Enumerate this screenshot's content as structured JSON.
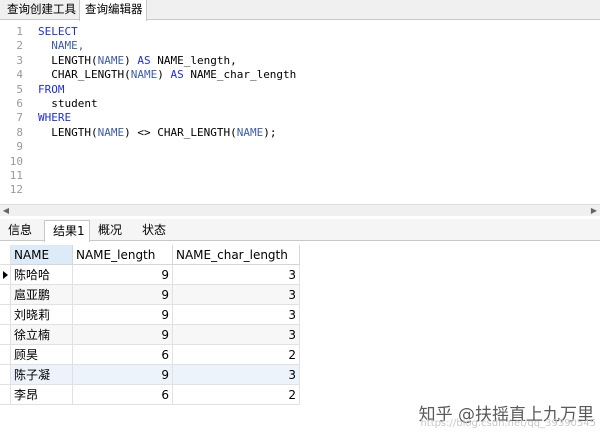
{
  "top_tabs": [
    "查询创建工具",
    "查询编辑器"
  ],
  "editor": {
    "line_numbers": [
      "1",
      "2",
      "3",
      "4",
      "5",
      "6",
      "7",
      "8",
      "9",
      "10",
      "11",
      "12"
    ],
    "lines": [
      [
        {
          "t": "SELECT",
          "c": "kw"
        }
      ],
      [
        {
          "t": "  NAME,",
          "c": "id"
        }
      ],
      [
        {
          "t": "  LENGTH(",
          "c": "fn"
        },
        {
          "t": "NAME",
          "c": "id"
        },
        {
          "t": ") ",
          "c": "fn"
        },
        {
          "t": "AS",
          "c": "kw"
        },
        {
          "t": " NAME_length,",
          "c": "fn"
        }
      ],
      [
        {
          "t": "  CHAR_LENGTH(",
          "c": "fn"
        },
        {
          "t": "NAME",
          "c": "id"
        },
        {
          "t": ") ",
          "c": "fn"
        },
        {
          "t": "AS",
          "c": "kw"
        },
        {
          "t": " NAME_char_length",
          "c": "fn"
        }
      ],
      [
        {
          "t": "FROM",
          "c": "kw"
        }
      ],
      [
        {
          "t": "  student",
          "c": "fn"
        }
      ],
      [
        {
          "t": "WHERE",
          "c": "kw"
        }
      ],
      [
        {
          "t": "  LENGTH(",
          "c": "fn"
        },
        {
          "t": "NAME",
          "c": "id"
        },
        {
          "t": ") <> CHAR_LENGTH(",
          "c": "fn"
        },
        {
          "t": "NAME",
          "c": "id"
        },
        {
          "t": ");",
          "c": "fn"
        }
      ],
      [],
      [],
      [],
      []
    ]
  },
  "result_tabs": [
    "信息",
    "结果1",
    "概况",
    "状态"
  ],
  "grid": {
    "columns": [
      "NAME",
      "NAME_length",
      "NAME_char_length"
    ],
    "rows": [
      [
        "陈哈哈",
        "9",
        "3"
      ],
      [
        "扈亚鹏",
        "9",
        "3"
      ],
      [
        "刘晓莉",
        "9",
        "3"
      ],
      [
        "徐立楠",
        "9",
        "3"
      ],
      [
        "顾昊",
        "6",
        "2"
      ],
      [
        "陈子凝",
        "9",
        "3"
      ],
      [
        "李昂",
        "6",
        "2"
      ]
    ]
  },
  "watermark": {
    "text": "知乎 @扶摇直上九万里",
    "sub": "https://blog.csdn.net/qq_39390545"
  },
  "colors": {
    "keyword": "#1e2ee0",
    "identifier": "#3d5cab",
    "header_selected": "#ddeaf8"
  }
}
